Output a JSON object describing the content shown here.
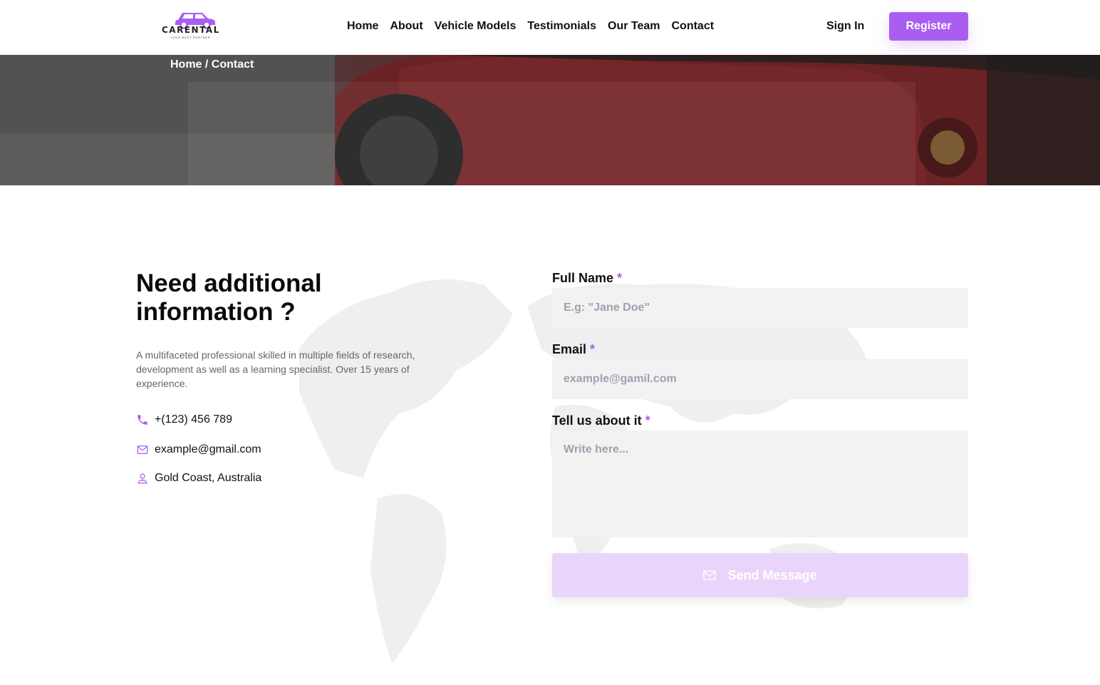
{
  "header": {
    "logo_text": "CARENTAL",
    "logo_tagline": "YOUR BEST PARTNER",
    "nav": [
      "Home",
      "About",
      "Vehicle Models",
      "Testimonials",
      "Our Team",
      "Contact"
    ],
    "sign_in": "Sign In",
    "register": "Register"
  },
  "hero": {
    "breadcrumb": "Home / Contact"
  },
  "info": {
    "title": "Need additional information ?",
    "description": "A multifaceted professional skilled in multiple fields of research, development as well as a learning specialist. Over 15 years of experience.",
    "phone": "+(123) 456 789",
    "email": "example@gmail.com",
    "location": "Gold Coast, Australia"
  },
  "form": {
    "full_name_label": "Full Name",
    "full_name_placeholder": "E.g: \"Jane Doe\"",
    "email_label": "Email",
    "email_placeholder": "example@gamil.com",
    "message_label": "Tell us about it",
    "message_placeholder": "Write here...",
    "required_mark": "*",
    "send_label": "Send Message"
  },
  "colors": {
    "accent": "#a95ef0",
    "accent_light": "#e9d5fb",
    "input_bg": "#f2f2f2"
  }
}
